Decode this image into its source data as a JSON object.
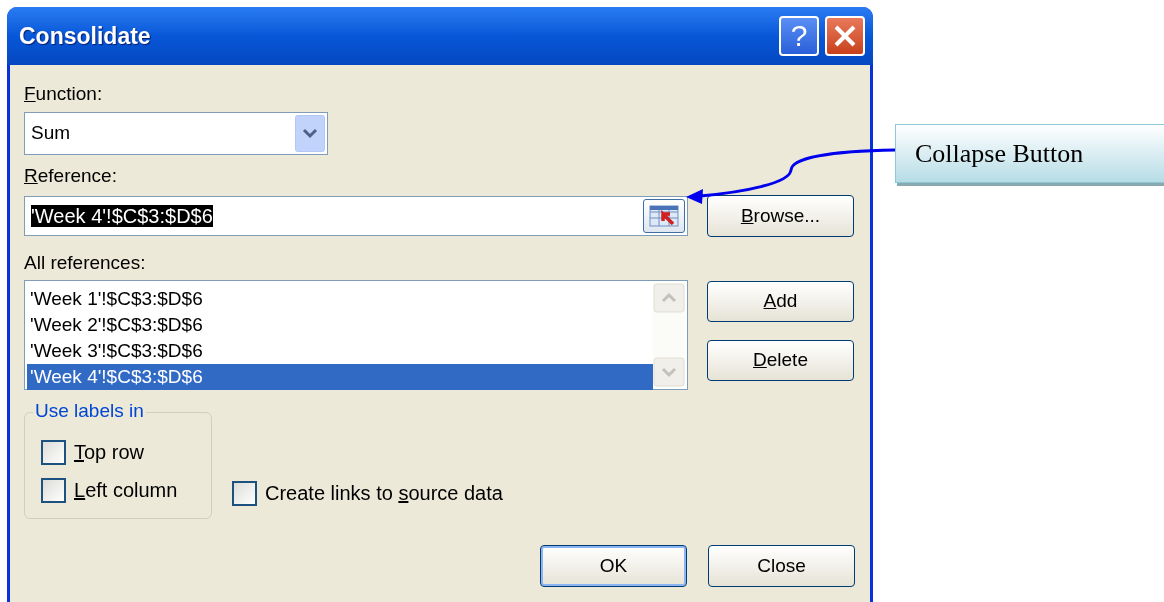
{
  "window": {
    "title": "Consolidate",
    "title_buttons": [
      {
        "kind": "help",
        "glyph": "?"
      },
      {
        "kind": "close"
      }
    ]
  },
  "function": {
    "label": {
      "key": "F",
      "after": "unction:"
    },
    "value": "Sum"
  },
  "reference": {
    "label": {
      "key": "R",
      "after": "eference:"
    },
    "value": "'Week 4'!$C$3:$D$6",
    "value_selected": true
  },
  "browse_button": {
    "key": "B",
    "after": "rowse..."
  },
  "all_references": {
    "label": {
      "before": "All references:"
    },
    "items": [
      {
        "text": "'Week 1'!$C$3:$D$6",
        "selected": false
      },
      {
        "text": "'Week 2'!$C$3:$D$6",
        "selected": false
      },
      {
        "text": "'Week 3'!$C$3:$D$6",
        "selected": false
      },
      {
        "text": "'Week 4'!$C$3:$D$6",
        "selected": true
      }
    ]
  },
  "side_buttons": [
    {
      "key": "A",
      "after": "dd"
    },
    {
      "key": "D",
      "after": "elete"
    }
  ],
  "use_labels": {
    "legend": "Use labels in",
    "options": [
      {
        "key": "T",
        "after": "op row",
        "checked": false
      },
      {
        "key": "L",
        "after": "eft column",
        "checked": false
      }
    ]
  },
  "create_links": {
    "before": "Create links to ",
    "key": "s",
    "after": "ource data",
    "checked": false
  },
  "footer_buttons": [
    {
      "label": "OK",
      "default": true
    },
    {
      "label": "Close",
      "default": false
    }
  ],
  "callout": {
    "text": "Collapse Button"
  }
}
